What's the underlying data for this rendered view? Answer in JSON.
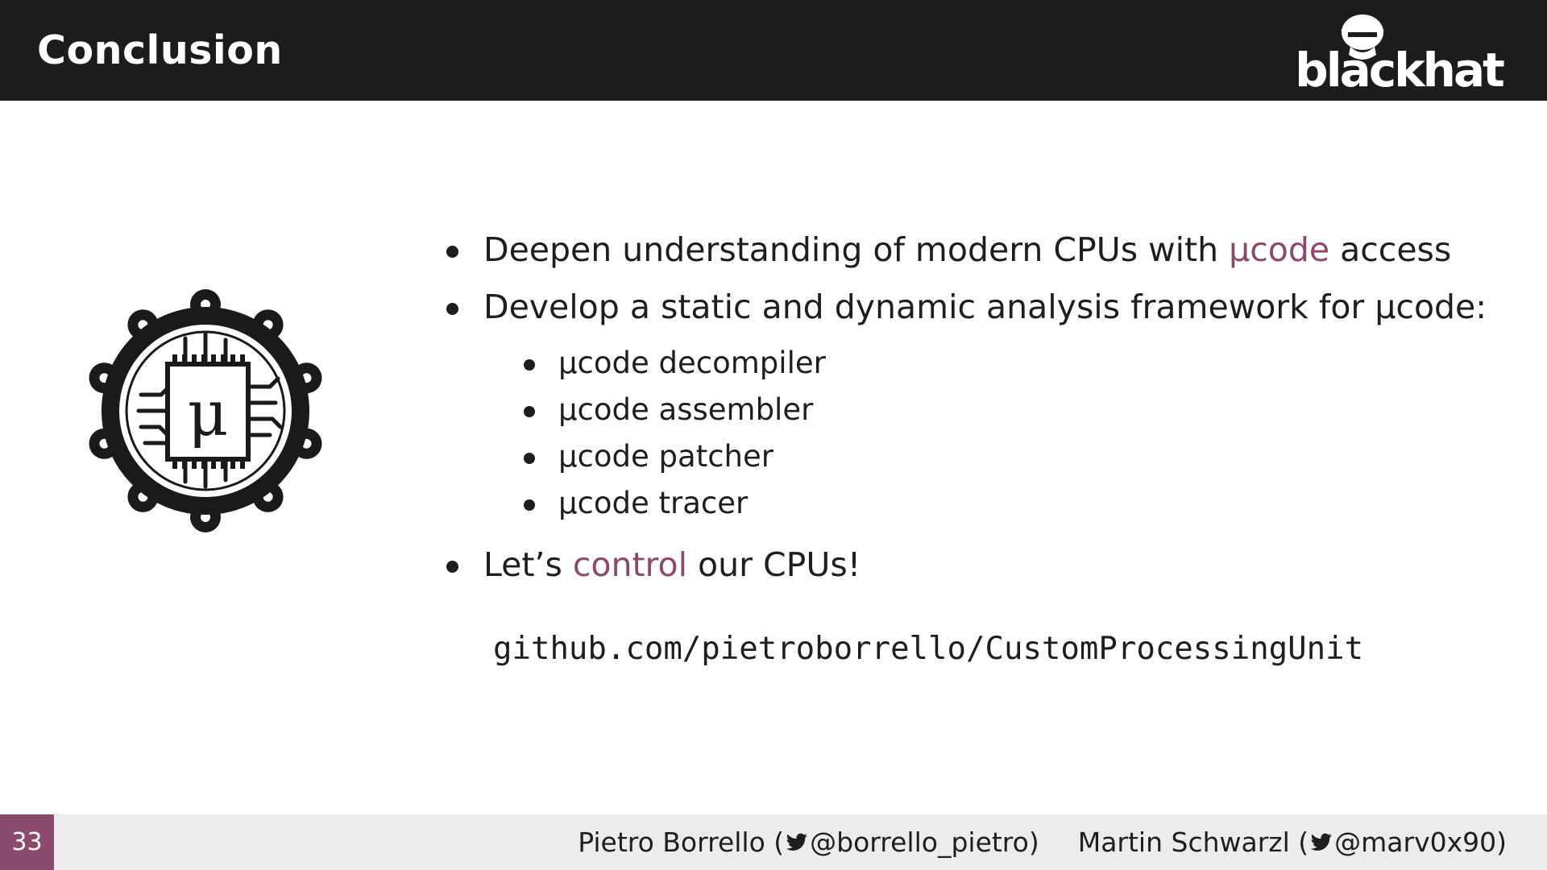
{
  "header": {
    "title": "Conclusion",
    "logo_text": "blackhat"
  },
  "emblem": {
    "symbol": "μ",
    "icon": "processor-gear-emblem-icon"
  },
  "bullets": [
    {
      "pre": "Deepen understanding of modern CPUs with ",
      "accent": "µcode",
      "post": " access"
    },
    {
      "pre": "Develop a static and dynamic analysis framework for µcode:",
      "accent": "",
      "post": ""
    }
  ],
  "sub_bullets": [
    {
      "text": "µcode decompiler"
    },
    {
      "text": "µcode assembler"
    },
    {
      "text": "µcode patcher"
    },
    {
      "text": "µcode tracer"
    }
  ],
  "last_bullet": {
    "pre": "Let’s ",
    "accent": "control",
    "post": " our CPUs!"
  },
  "repo_link": "github.com/pietroborrello/CustomProcessingUnit",
  "footer": {
    "page_number": "33",
    "authors": [
      {
        "name_pre": "Pietro Borrello (",
        "handle": "@borrello_pietro",
        "name_post": ")"
      },
      {
        "name_pre": "Martin Schwarzl (",
        "handle": "@marv0x90",
        "name_post": ")"
      }
    ]
  },
  "colors": {
    "header_bg": "#1c1c1c",
    "accent": "#8b4a6b",
    "footer_bg": "#ececec"
  }
}
